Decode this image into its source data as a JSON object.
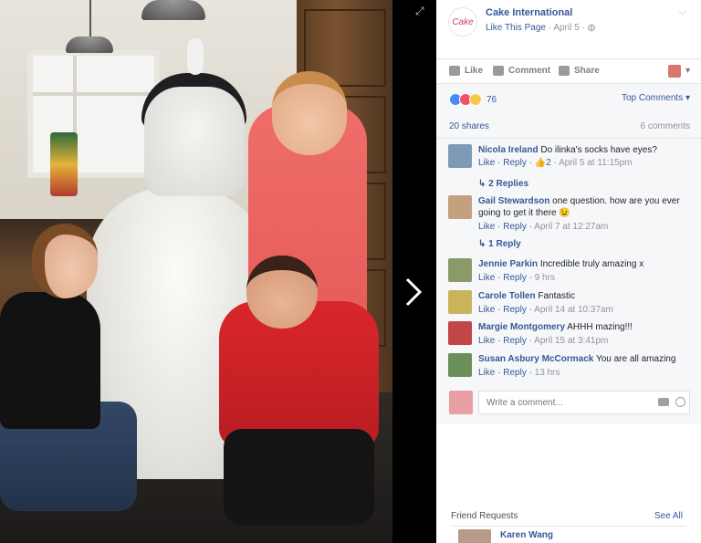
{
  "post": {
    "page_name": "Cake International",
    "page_logo_text": "Cake",
    "like_page": "Like This Page",
    "date": "April 5",
    "separator": "·"
  },
  "actions": {
    "like": "Like",
    "comment": "Comment",
    "share": "Share"
  },
  "reactions": {
    "count": "76",
    "top_comments": "Top Comments ▾"
  },
  "stats": {
    "shares": "20 shares",
    "comments": "6 comments"
  },
  "comments": [
    {
      "author": "Nicola Ireland",
      "text": "Do ilinka's socks have eyes?",
      "like": "Like",
      "reply": "Reply",
      "likes_count": "2",
      "time": "April 5 at 11:15pm",
      "replies": "2 Replies",
      "avatar_color": "#7d9bb5"
    },
    {
      "author": "Gail Stewardson",
      "text": "one question. how are you ever going to get it there 😉",
      "like": "Like",
      "reply": "Reply",
      "likes_count": "",
      "time": "April 7 at 12:27am",
      "replies": "1 Reply",
      "avatar_color": "#c4a080"
    },
    {
      "author": "Jennie Parkin",
      "text": "Incredible truly amazing x",
      "like": "Like",
      "reply": "Reply",
      "likes_count": "",
      "time": "9 hrs",
      "replies": "",
      "avatar_color": "#8a9a6a"
    },
    {
      "author": "Carole Tollen",
      "text": "Fantastic",
      "like": "Like",
      "reply": "Reply",
      "likes_count": "",
      "time": "April 14 at 10:37am",
      "replies": "",
      "avatar_color": "#c9b45c"
    },
    {
      "author": "Margie Montgomery",
      "text": "AHHH mazing!!!",
      "like": "Like",
      "reply": "Reply",
      "likes_count": "",
      "time": "April 15 at 3:41pm",
      "replies": "",
      "avatar_color": "#c0464a"
    },
    {
      "author": "Susan Asbury McCormack",
      "text": "You are all amazing",
      "like": "Like",
      "reply": "Reply",
      "likes_count": "",
      "time": "13 hrs",
      "replies": "",
      "avatar_color": "#6a8f5a"
    }
  ],
  "composer": {
    "placeholder": "Write a comment..."
  },
  "friend_requests": {
    "title": "Friend Requests",
    "see_all": "See All",
    "name": "Karen Wang"
  }
}
